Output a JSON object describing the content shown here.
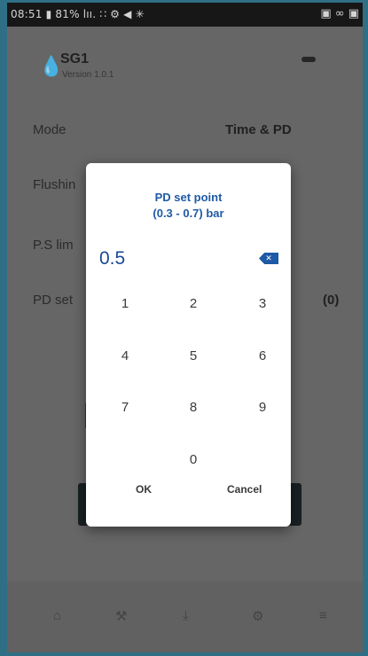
{
  "status_bar": {
    "left": "08:51 ▮ 81% lıı. ∷ ⚙ ◀ ✳",
    "right": "▣ ∞ ▣"
  },
  "app": {
    "device_name": "SG1",
    "version": "Version 1.0.1",
    "rows": [
      {
        "label": "Mode",
        "value": "Time & PD"
      },
      {
        "label": "Flushin",
        "value": ""
      },
      {
        "label": "P.S lim",
        "value": ""
      },
      {
        "label": "PD set",
        "value": "(0)"
      }
    ]
  },
  "dialog": {
    "title_line1": "PD set point",
    "title_line2": "(0.3 - 0.7) bar",
    "value": "0.5",
    "backspace_glyph": "✕",
    "keys": [
      "1",
      "2",
      "3",
      "4",
      "5",
      "6",
      "7",
      "8",
      "9",
      "0"
    ],
    "ok_label": "OK",
    "cancel_label": "Cancel",
    "accent_color": "#1e5aa6"
  }
}
